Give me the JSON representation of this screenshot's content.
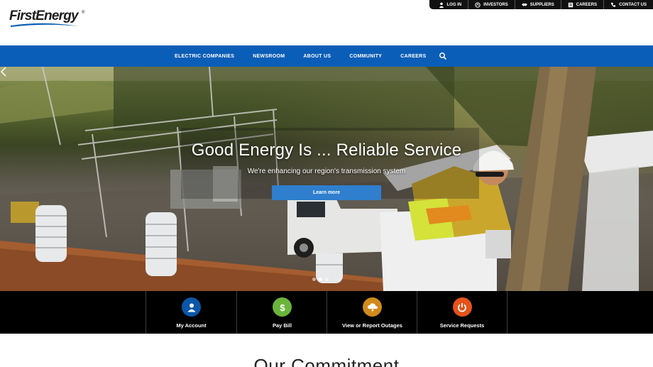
{
  "brand": {
    "name": "FirstEnergy",
    "registered": "®",
    "primary_color": "#0b5eb7",
    "swoosh_color": "#0b5eb7"
  },
  "utility_nav": [
    {
      "label": "LOG IN",
      "icon": "user-icon"
    },
    {
      "label": "INVESTORS",
      "icon": "investors-icon"
    },
    {
      "label": "SUPPLIERS",
      "icon": "handshake-icon"
    },
    {
      "label": "CAREERS",
      "icon": "careers-icon"
    },
    {
      "label": "CONTACT US",
      "icon": "phone-icon"
    }
  ],
  "main_nav": [
    {
      "label": "ELECTRIC COMPANIES"
    },
    {
      "label": "NEWSROOM"
    },
    {
      "label": "ABOUT US"
    },
    {
      "label": "COMMUNITY"
    },
    {
      "label": "CAREERS"
    }
  ],
  "hero": {
    "title": "Good Energy Is ... Reliable Service",
    "subtitle": "We're enhancing our region's transmission system",
    "button_label": "Learn more",
    "slides_total": 3,
    "active_slide": 1
  },
  "quick_links": [
    {
      "label": "My Account",
      "icon": "person-icon",
      "color": "#0a57a8"
    },
    {
      "label": "Pay Bill",
      "icon": "dollar-icon",
      "color": "#6ab43c"
    },
    {
      "label": "View or Report Outages",
      "icon": "cloud-lightning-icon",
      "color": "#d18a1c"
    },
    {
      "label": "Service Requests",
      "icon": "power-icon",
      "color": "#e5531a"
    }
  ],
  "section": {
    "heading": "Our Commitment"
  }
}
